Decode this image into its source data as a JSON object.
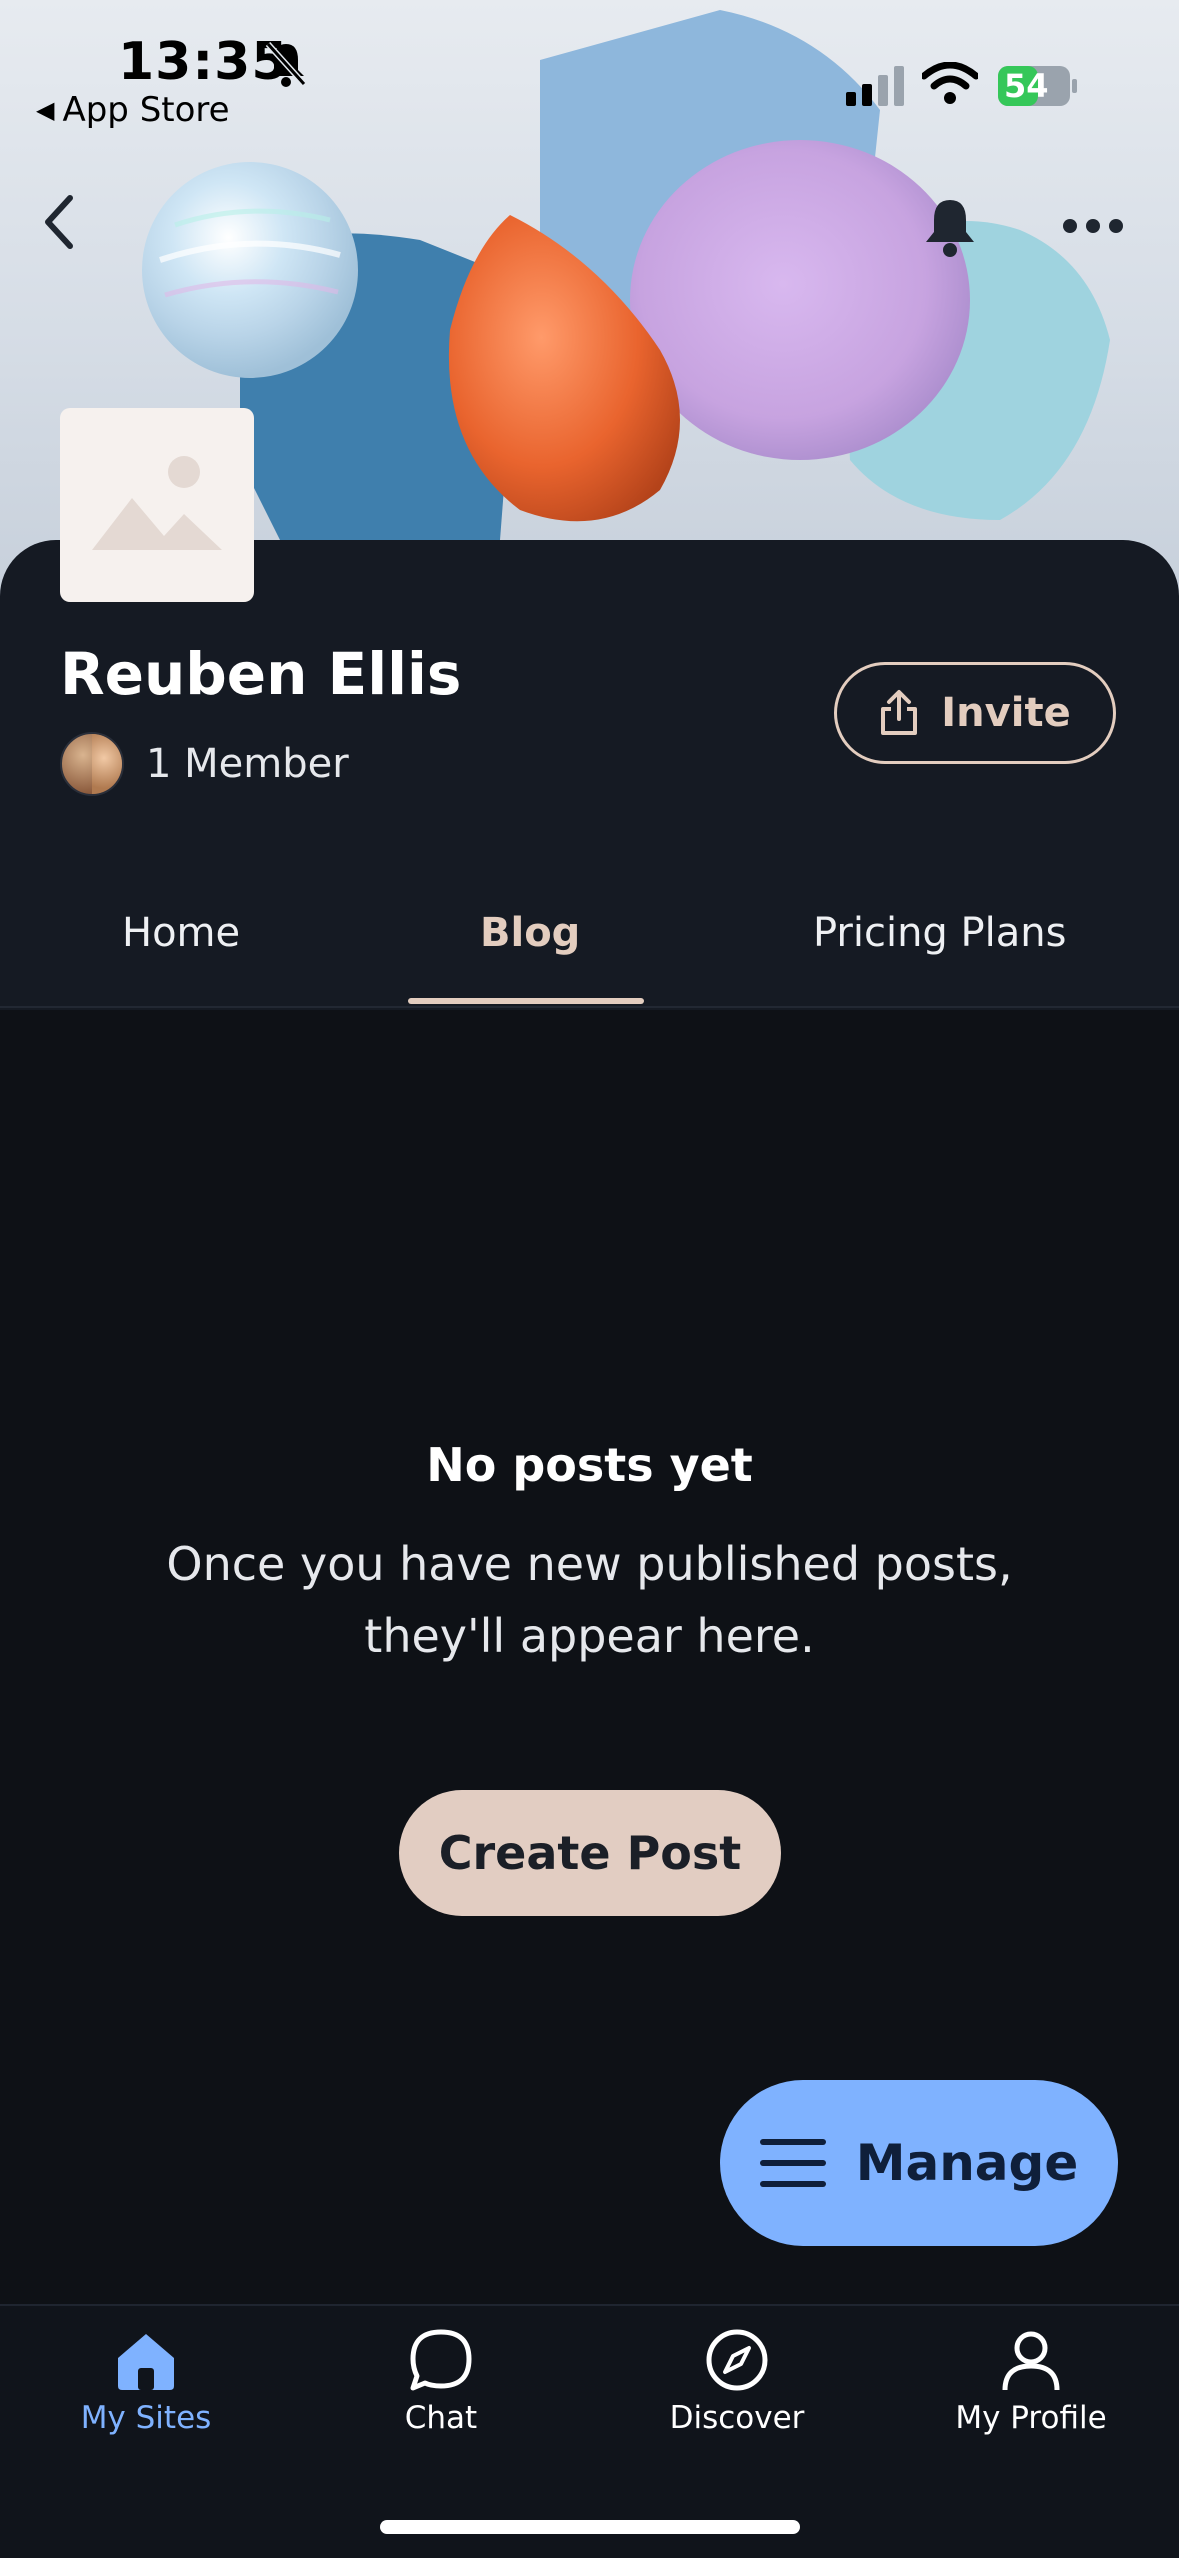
{
  "status_bar": {
    "time": "13:35",
    "back_app": "App Store",
    "battery": "54"
  },
  "site": {
    "name": "Reuben Ellis",
    "members": "1 Member",
    "invite_label": "Invite"
  },
  "tabs": [
    {
      "label": "Home",
      "active": false
    },
    {
      "label": "Blog",
      "active": true
    },
    {
      "label": "Pricing Plans",
      "active": false
    }
  ],
  "empty_state": {
    "title": "No posts yet",
    "text": "Once you have new published posts, they'll appear here.",
    "button": "Create Post"
  },
  "manage_label": "Manage",
  "bottom_nav": [
    {
      "label": "My Sites",
      "icon": "home-icon",
      "active": true
    },
    {
      "label": "Chat",
      "icon": "chat-icon",
      "active": false
    },
    {
      "label": "Discover",
      "icon": "compass-icon",
      "active": false
    },
    {
      "label": "My Profile",
      "icon": "profile-icon",
      "active": false
    }
  ],
  "colors": {
    "background": "#0e1116",
    "card": "#151a23",
    "accent_beige": "#e3cdbf",
    "accent_blue": "#7fb2ff"
  }
}
